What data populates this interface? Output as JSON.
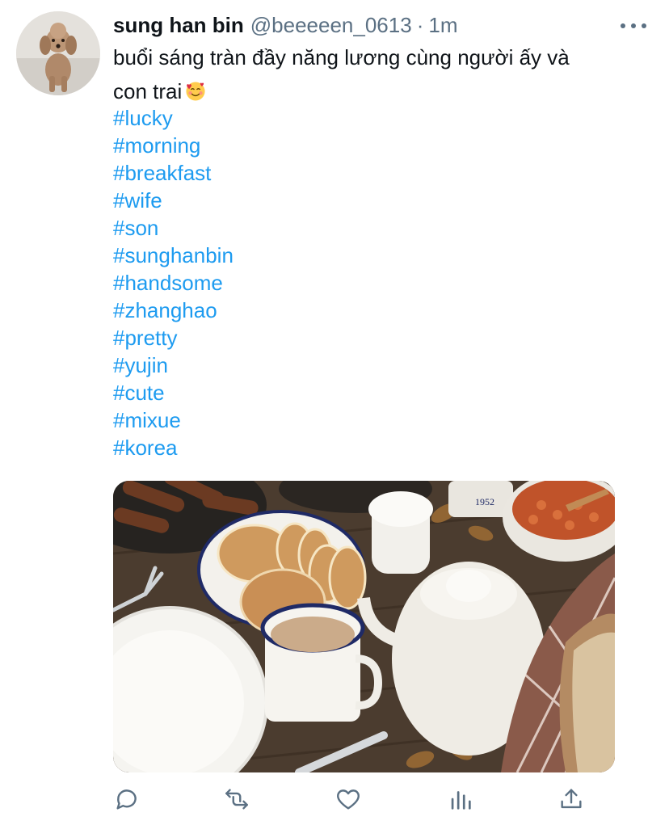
{
  "tweet": {
    "display_name": "sung han bin",
    "handle": "@beeeeen_0613",
    "separator": "·",
    "time": "1m",
    "text_line1": "buổi sáng tràn đầy năng lương cùng người ấy và",
    "text_line2": "con trai",
    "emoji": "smiling-face-with-hearts",
    "hashtags": [
      "#lucky",
      "#morning",
      "#breakfast",
      "#wife",
      "#son",
      "#sunghanbin",
      "#handsome",
      "#zhanghao",
      "#pretty",
      "#yujin",
      "#cute",
      "#mixue",
      "#korea"
    ]
  },
  "colors": {
    "accent": "#1d9bf0",
    "secondary_text": "#5b7083",
    "primary_text": "#0f1419"
  },
  "actions": [
    "reply-icon",
    "retweet-icon",
    "like-icon",
    "analytics-icon",
    "share-icon"
  ]
}
